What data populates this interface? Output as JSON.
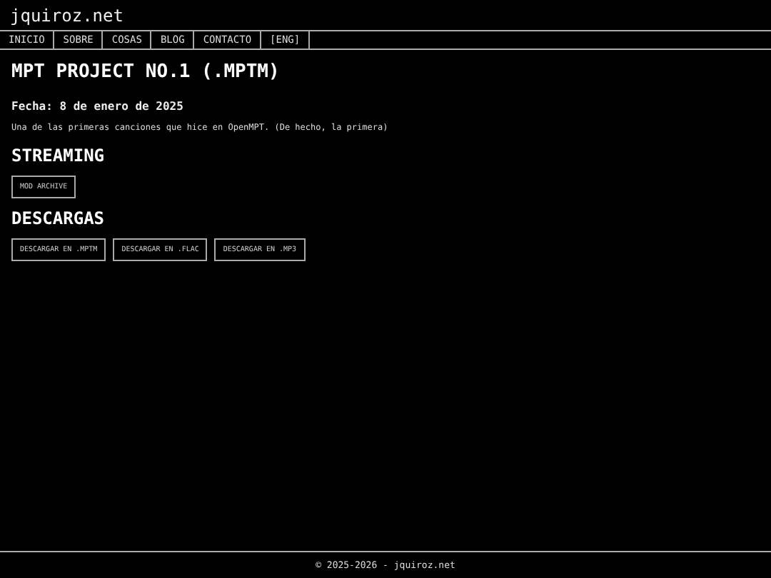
{
  "site": {
    "title": "jquiroz.net"
  },
  "nav": [
    {
      "label": "INICIO"
    },
    {
      "label": "SOBRE"
    },
    {
      "label": "COSAS"
    },
    {
      "label": "BLOG"
    },
    {
      "label": "CONTACTO"
    },
    {
      "label": "[ENG]"
    }
  ],
  "page": {
    "title": "MPT PROJECT NO.1 (.MPTM)",
    "date": "Fecha: 8 de enero de 2025",
    "description": "Una de las primeras canciones que hice en OpenMPT. (De hecho, la primera)"
  },
  "sections": [
    {
      "heading": "STREAMING",
      "buttons": [
        "MOD ARCHIVE"
      ]
    },
    {
      "heading": "DESCARGAS",
      "buttons": [
        "DESCARGAR EN .MPTM",
        "DESCARGAR EN .FLAC",
        "DESCARGAR EN .MP3"
      ]
    }
  ],
  "footer": {
    "text": "© 2025-2026 - jquiroz.net"
  }
}
